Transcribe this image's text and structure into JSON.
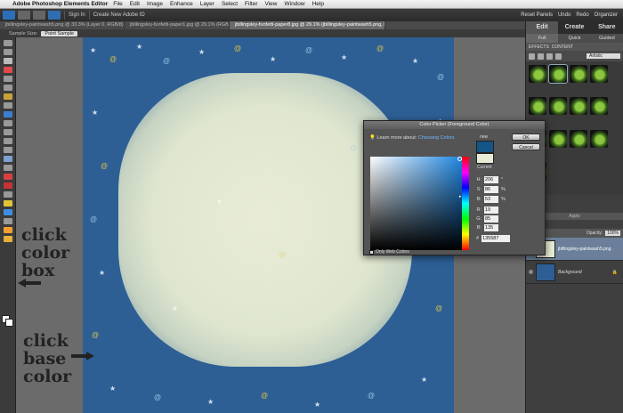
{
  "menubar": {
    "app_name": "Adobe Photoshop Elements Editor",
    "items": [
      "File",
      "Edit",
      "Image",
      "Enhance",
      "Layer",
      "Select",
      "Filter",
      "View",
      "Window",
      "Help"
    ]
  },
  "options": {
    "sign_in": "Sign In",
    "create_id": "Create New Adobe ID",
    "reset_panels": "Reset Panels",
    "undo": "Undo",
    "redo": "Redo",
    "organizer": "Organizer"
  },
  "tabs": [
    "jbillingsley-paintwash5.png @ 33.3% (Layer 0, RGB/8)",
    "jbillingsley-funfetti-paper1.jpg @ 29.1% (RGB/8)",
    "jbillingsley-funfetti-paper8.jpg @ 29.1% (jbillingsley-paintwash5.png, RGB/8)"
  ],
  "sample": {
    "label": "Sample Size:",
    "value": "Point Sample"
  },
  "annotations": {
    "top": [
      "click",
      "color",
      "box"
    ],
    "bottom": [
      "click",
      "base",
      "color"
    ]
  },
  "panel": {
    "tabs": [
      "Edit",
      "Create",
      "Share"
    ],
    "subtabs": [
      "Full",
      "Quick",
      "Guided"
    ],
    "effects_label": "EFFECTS",
    "content_label": "CONTENT",
    "category": "Artistic",
    "apply": "Apply",
    "opacity_label": "Opacity:",
    "opacity_value": "100%",
    "layers": [
      {
        "name": "jbillingsley-paintwash5.png",
        "selected": true
      },
      {
        "name": "Background",
        "selected": false
      }
    ]
  },
  "dialog": {
    "title": "Color Picker (Foreground Color)",
    "learn_prefix": "Learn more about:",
    "learn_link": "Choosing Colors",
    "new_label": "new",
    "current_label": "Current",
    "ok": "OK",
    "cancel": "Cancel",
    "fields": [
      {
        "label": "H:",
        "value": "206",
        "unit": "°"
      },
      {
        "label": "S:",
        "value": "86",
        "unit": "%"
      },
      {
        "label": "B:",
        "value": "53",
        "unit": "%"
      },
      {
        "label": "R:",
        "value": "19",
        "unit": ""
      },
      {
        "label": "G:",
        "value": "85",
        "unit": ""
      },
      {
        "label": "B:",
        "value": "135",
        "unit": ""
      }
    ],
    "hex_prefix": "#",
    "hex": "135587",
    "web_only": "Only Web Colors",
    "new_color": "#135587",
    "current_color": "#e8ecd6"
  }
}
